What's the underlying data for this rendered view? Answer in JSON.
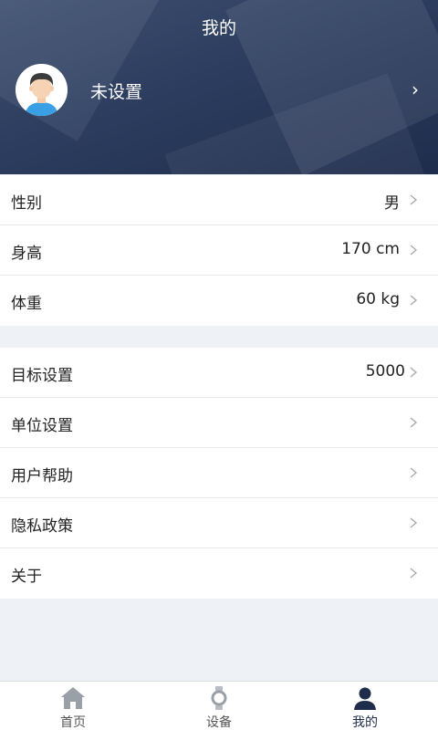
{
  "header": {
    "title": "我的"
  },
  "profile": {
    "name": "未设置",
    "arrow": "›"
  },
  "profile_group": [
    {
      "label": "性别",
      "value": "男"
    },
    {
      "label": "身高",
      "value": "170 cm"
    },
    {
      "label": "体重",
      "value": "60 kg"
    }
  ],
  "settings_group": [
    {
      "label": "目标设置",
      "value": "5000"
    },
    {
      "label": "单位设置",
      "value": ""
    },
    {
      "label": "用户帮助",
      "value": ""
    },
    {
      "label": "隐私政策",
      "value": ""
    },
    {
      "label": "关于",
      "value": ""
    }
  ],
  "tabbar": {
    "tabs": [
      {
        "label": "首页",
        "icon": "home-icon",
        "active": false
      },
      {
        "label": "设备",
        "icon": "watch-icon",
        "active": false
      },
      {
        "label": "我的",
        "icon": "person-icon",
        "active": true
      }
    ]
  },
  "colors": {
    "header_dark": "#1f2d4d",
    "background": "#eef1f5",
    "tab_inactive": "#9aa0a8",
    "tab_active": "#1f2d4d"
  }
}
